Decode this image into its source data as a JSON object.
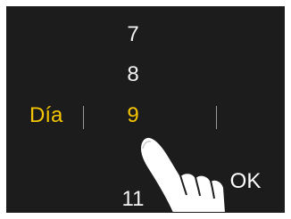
{
  "screen": {
    "background": "#1c1c1c",
    "accent_color": "#f5c400"
  },
  "picker": {
    "field_label": "Día",
    "items": [
      "7",
      "8",
      "9",
      "11"
    ],
    "selected_value": "9"
  },
  "ok_button": {
    "label": "OK"
  },
  "icons": {
    "pointer": "hand-pointer-icon"
  }
}
